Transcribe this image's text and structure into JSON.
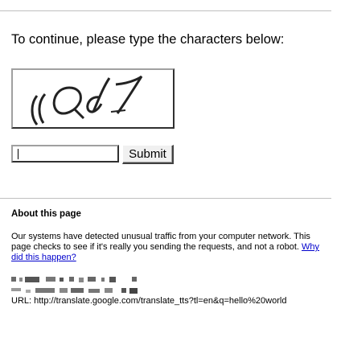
{
  "prompt": "To continue, please type the characters below:",
  "captcha": {
    "text": "(Qd7"
  },
  "form": {
    "input_value": "",
    "submit_label": "Submit"
  },
  "about": {
    "title": "About this page",
    "body": "Our systems have detected unusual traffic from your computer network. This page checks to see if it's really you sending the requests, and not a robot.",
    "link_text": "Why did this happen?"
  },
  "info": {
    "url_label": "URL:",
    "url_value": "http://translate.google.com/translate_tts?tl=en&q=hello%20world"
  },
  "colors": {
    "link": "#0000cc",
    "divider": "#bfbfbf"
  }
}
